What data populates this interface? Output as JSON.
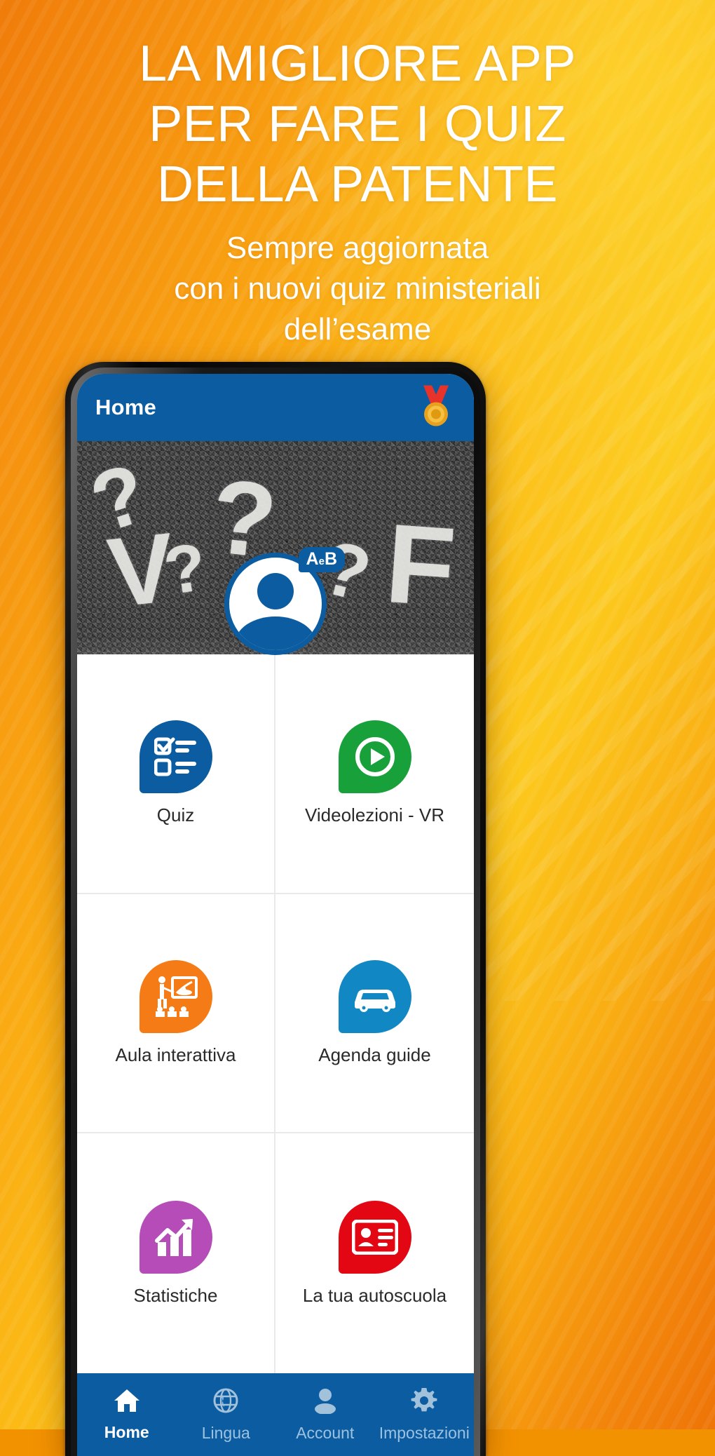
{
  "promo": {
    "headline_lines": [
      "LA MIGLIORE APP",
      "PER FARE I QUIZ",
      "DELLA PATENTE"
    ],
    "subtitle_lines": [
      "Sempre aggiornata",
      "con i nuovi quiz ministeriali",
      "dell’esame"
    ]
  },
  "app": {
    "appbar": {
      "title": "Home",
      "medal_icon": "medal-icon"
    },
    "hero": {
      "road_marks": [
        "?",
        "?",
        "?",
        "?",
        "F",
        "V"
      ]
    },
    "avatar": {
      "badge_prefix": "A",
      "badge_middle": "e",
      "badge_suffix": "B",
      "badge_text": "AeB"
    },
    "grid": [
      {
        "label": "Quiz",
        "icon": "quiz-checklist-icon",
        "color": "#0b5ca0"
      },
      {
        "label": "Videolezioni - VR",
        "icon": "play-circle-icon",
        "color": "#18a03a"
      },
      {
        "label": "Aula interattiva",
        "icon": "classroom-icon",
        "color": "#f47b15"
      },
      {
        "label": "Agenda guide",
        "icon": "car-icon",
        "color": "#1187c4"
      },
      {
        "label": "Statistiche",
        "icon": "bar-chart-icon",
        "color": "#b54cb8"
      },
      {
        "label": "La tua autoscuola",
        "icon": "id-card-icon",
        "color": "#e30613"
      }
    ],
    "bottom_nav": [
      {
        "label": "Home",
        "icon": "home-icon",
        "active": true
      },
      {
        "label": "Lingua",
        "icon": "globe-icon",
        "active": false
      },
      {
        "label": "Account",
        "icon": "person-icon",
        "active": false
      },
      {
        "label": "Impostazioni",
        "icon": "gear-icon",
        "active": false
      }
    ]
  },
  "colors": {
    "brand_blue": "#0b5ca0",
    "bg_orange": "#f39200",
    "bg_yellow": "#fcc81c"
  }
}
